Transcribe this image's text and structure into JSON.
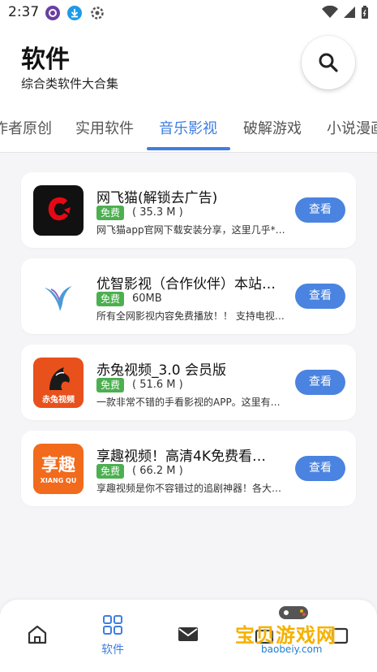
{
  "status_bar": {
    "time": "2:37"
  },
  "header": {
    "title": "软件",
    "subtitle": "综合类软件大合集"
  },
  "tabs": [
    {
      "label": "作者原创"
    },
    {
      "label": "实用软件"
    },
    {
      "label": "音乐影视"
    },
    {
      "label": "破解游戏"
    },
    {
      "label": "小说漫画"
    }
  ],
  "apps": [
    {
      "name": "网飞猫(解锁去广告)",
      "badge": "免费",
      "size": "( 35.3 M )",
      "desc": "网飞猫app官网下载安装分享，这里几乎*…",
      "button": "查看",
      "icon": "netflix-cat-app-icon"
    },
    {
      "name": "优智影视（合作伙伴）本站…",
      "badge": "免费",
      "size": "60MB",
      "desc": "所有全网影视内容免费播放！！ 支持电视…",
      "button": "查看",
      "icon": "youzhi-app-icon"
    },
    {
      "name": "赤兔视频_3.0 会员版",
      "badge": "免费",
      "size": "( 51.6 M )",
      "desc": "一款非常不错的手看影视的APP。这里有…",
      "button": "查看",
      "icon": "chitu-app-icon",
      "icon_text": "赤兔视频"
    },
    {
      "name": "享趣视频！高清4K免费看…",
      "badge": "免费",
      "size": "( 66.2 M )",
      "desc": "享趣视频是你不容错过的追剧神器！各大…",
      "button": "查看",
      "icon": "xiangqu-app-icon",
      "icon_text": "享趣",
      "icon_subtext": "XIANG QU"
    }
  ],
  "bottom_nav": [
    {
      "icon": "home-icon"
    },
    {
      "icon": "apps-grid-icon",
      "label": "软件"
    },
    {
      "icon": "message-icon"
    },
    {
      "icon": "bag-icon"
    },
    {
      "icon": "profile-icon"
    }
  ],
  "watermark": {
    "text": "宝贝游戏网",
    "url": "baobeiy.com"
  },
  "colors": {
    "accent": "#3f7ee0",
    "badge": "#4caf50",
    "button": "#4a83e0",
    "background": "#f5f5f7"
  }
}
